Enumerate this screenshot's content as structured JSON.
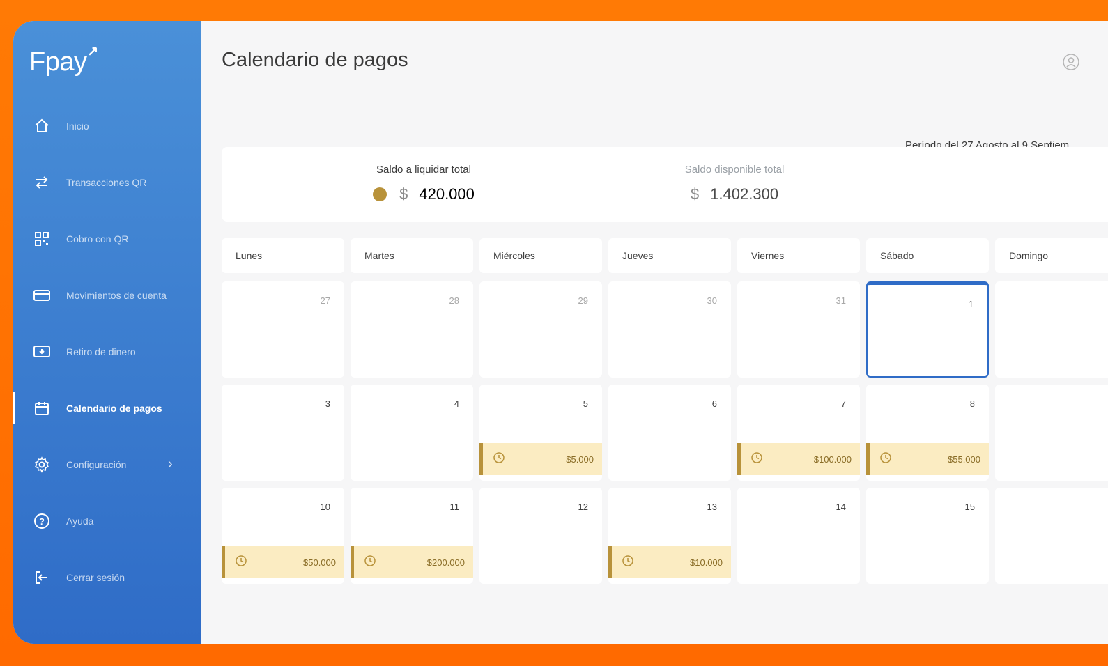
{
  "app": {
    "logo": "Fpay",
    "logo_mark": "↗"
  },
  "sidebar": {
    "items": [
      {
        "label": "Inicio",
        "icon": "home-icon",
        "active": false
      },
      {
        "label": "Transacciones QR",
        "icon": "transfer-arrows-icon",
        "active": false
      },
      {
        "label": "Cobro con QR",
        "icon": "qr-code-icon",
        "active": false
      },
      {
        "label": "Movimientos de cuenta",
        "icon": "card-icon",
        "active": false
      },
      {
        "label": "Retiro de dinero",
        "icon": "cash-withdraw-icon",
        "active": false
      },
      {
        "label": "Calendario de pagos",
        "icon": "calendar-icon",
        "active": true
      },
      {
        "label": "Configuración",
        "icon": "gear-icon",
        "active": false
      },
      {
        "label": "Ayuda",
        "icon": "help-icon",
        "active": false
      },
      {
        "label": "Cerrar sesión",
        "icon": "logout-icon",
        "active": false
      }
    ]
  },
  "header": {
    "title": "Calendario de pagos",
    "user_icon": "user-icon"
  },
  "period": "Período del 27 Agosto al 9 Septiem",
  "summary": {
    "total_title": "Saldo a liquidar total",
    "total_currency": "$",
    "total_amount": "420.000",
    "available_title": "Saldo disponible total",
    "available_currency": "$",
    "available_amount": "1.402.300"
  },
  "calendar": {
    "days": [
      "Lunes",
      "Martes",
      "Miércoles",
      "Jueves",
      "Viernes",
      "Sábado",
      "Domingo"
    ],
    "weeks": [
      [
        {
          "num": "27",
          "past": true
        },
        {
          "num": "28",
          "past": true
        },
        {
          "num": "29",
          "past": true
        },
        {
          "num": "30",
          "past": true
        },
        {
          "num": "31",
          "past": true
        },
        {
          "num": "1",
          "today": true
        },
        {
          "num": ""
        }
      ],
      [
        {
          "num": "3"
        },
        {
          "num": "4"
        },
        {
          "num": "5",
          "payment": "$5.000"
        },
        {
          "num": "6"
        },
        {
          "num": "7",
          "payment": "$100.000"
        },
        {
          "num": "8",
          "payment": "$55.000"
        },
        {
          "num": ""
        }
      ],
      [
        {
          "num": "10",
          "payment": "$50.000"
        },
        {
          "num": "11",
          "payment": "$200.000"
        },
        {
          "num": "12"
        },
        {
          "num": "13",
          "payment": "$10.000"
        },
        {
          "num": "14"
        },
        {
          "num": "15"
        },
        {
          "num": ""
        }
      ]
    ]
  },
  "colors": {
    "accent": "#2f6cc7",
    "payment_bar": "#b8923a",
    "payment_bg": "#fbecc2",
    "background": "#ff6a00"
  }
}
